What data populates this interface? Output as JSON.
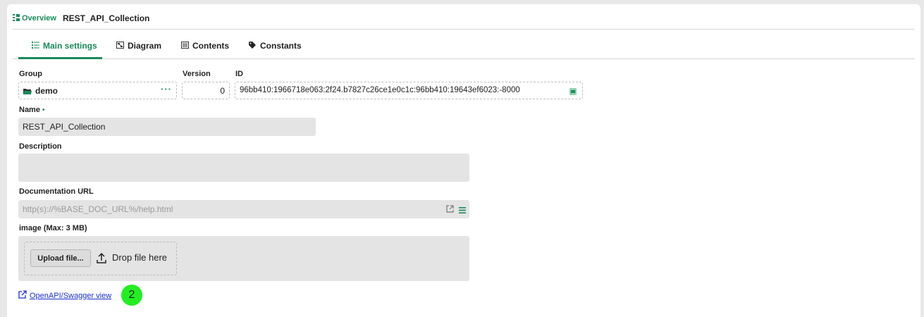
{
  "header": {
    "overview_label": "Overview",
    "title": "REST_API_Collection"
  },
  "tabs": [
    {
      "label": "Main settings",
      "icon": "list-icon",
      "active": true
    },
    {
      "label": "Diagram",
      "icon": "diagram-icon",
      "active": false
    },
    {
      "label": "Contents",
      "icon": "contents-icon",
      "active": false
    },
    {
      "label": "Constants",
      "icon": "tag-icon",
      "active": false
    }
  ],
  "form": {
    "group_label": "Group",
    "group_value": "demo",
    "version_label": "Version",
    "version_value": "0",
    "id_label": "ID",
    "id_value": "96bb410:1966718e063:2f24.b7827c26ce1e0c1c:96bb410:19643ef6023:-8000",
    "name_label": "Name",
    "name_required": "•",
    "name_value": "REST_API_Collection",
    "description_label": "Description",
    "description_value": "",
    "doc_url_label": "Documentation URL",
    "doc_url_placeholder": "http(s)://%BASE_DOC_URL%/help.html",
    "image_label": "image (Max: 3 MB)",
    "upload_label": "Upload file...",
    "drop_label": "Drop file here"
  },
  "link": {
    "swagger_label": "OpenAPI/Swagger view"
  },
  "marker": {
    "label": "2",
    "color": "#22ee22"
  },
  "colors": {
    "accent": "#1a8a5a",
    "link": "#1a2fd0"
  }
}
